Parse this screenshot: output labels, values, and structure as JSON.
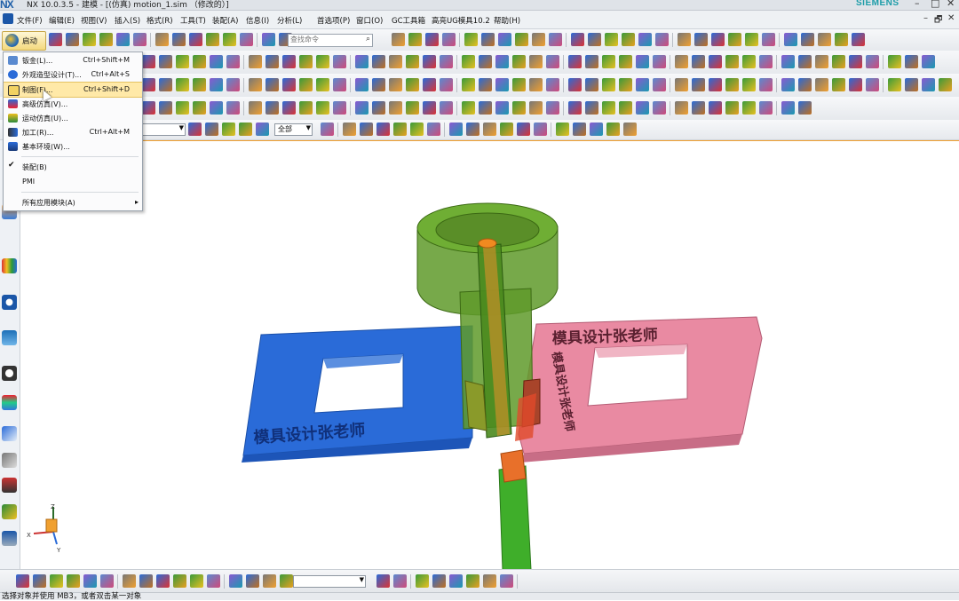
{
  "window": {
    "logo": "NX",
    "title": "NX 10.0.3.5 - 建模 - [(仿真) motion_1.sim （修改的）]",
    "brand": "SIEMENS",
    "minimize": "–",
    "maximize": "□",
    "close": "✕"
  },
  "menubar": {
    "items": [
      "文件(F)",
      "编辑(E)",
      "视图(V)",
      "插入(S)",
      "格式(R)",
      "工具(T)",
      "装配(A)",
      "信息(I)",
      "分析(L)",
      "首选项(P)",
      "窗口(O)",
      "GC工具箱",
      "高亮UG模具10.2",
      "帮助(H)"
    ],
    "controls": [
      "–",
      "🗗",
      "✕"
    ]
  },
  "toolbar": {
    "start_label": "启动",
    "search_placeholder": "查找命令",
    "filter_value": "",
    "assembly_scope": "全部",
    "bottom_combo_value": ""
  },
  "start_menu": {
    "items": [
      {
        "label": "钣金(L)...",
        "shortcut": "Ctrl+Shift+M",
        "icon": "sheetmetal-icon"
      },
      {
        "label": "外观造型设计(T)...",
        "shortcut": "Ctrl+Alt+S",
        "icon": "shape-studio-icon"
      },
      {
        "label": "制图(F)...",
        "shortcut": "Ctrl+Shift+D",
        "icon": "drafting-icon",
        "highlighted": true
      },
      {
        "label": "高级仿真(V)...",
        "shortcut": "",
        "icon": "advanced-simulation-icon"
      },
      {
        "label": "运动仿真(U)...",
        "shortcut": "",
        "icon": "motion-simulation-icon"
      },
      {
        "label": "加工(R)...",
        "shortcut": "Ctrl+Alt+M",
        "icon": "manufacturing-icon"
      },
      {
        "label": "基本环境(W)...",
        "shortcut": "",
        "icon": "gateway-icon"
      },
      {
        "label": "装配(B)",
        "shortcut": "",
        "icon": "check-icon",
        "checked": true
      },
      {
        "label": "PMI",
        "shortcut": "",
        "icon": ""
      },
      {
        "label": "所有应用模块(A)",
        "shortcut": "",
        "icon": "",
        "submenu": true
      }
    ]
  },
  "viewport": {
    "left_text": "模具设计张老师",
    "right_text_top": "模具设计张老师",
    "right_text_side": "模具设计张老师",
    "triad_labels": {
      "x": "X",
      "y": "Y",
      "z": "Z"
    }
  },
  "status": {
    "text": "选择对象并使用 MB3，或者双击某一对象"
  },
  "colors": {
    "accent_orange": "#f0a030",
    "plate_blue": "#2a6bd8",
    "plate_pink": "#e98aa2",
    "cylinder_green": "#5f9a2a",
    "rod_green": "#3fae2a",
    "menu_highlight": "#ffe9a8"
  }
}
